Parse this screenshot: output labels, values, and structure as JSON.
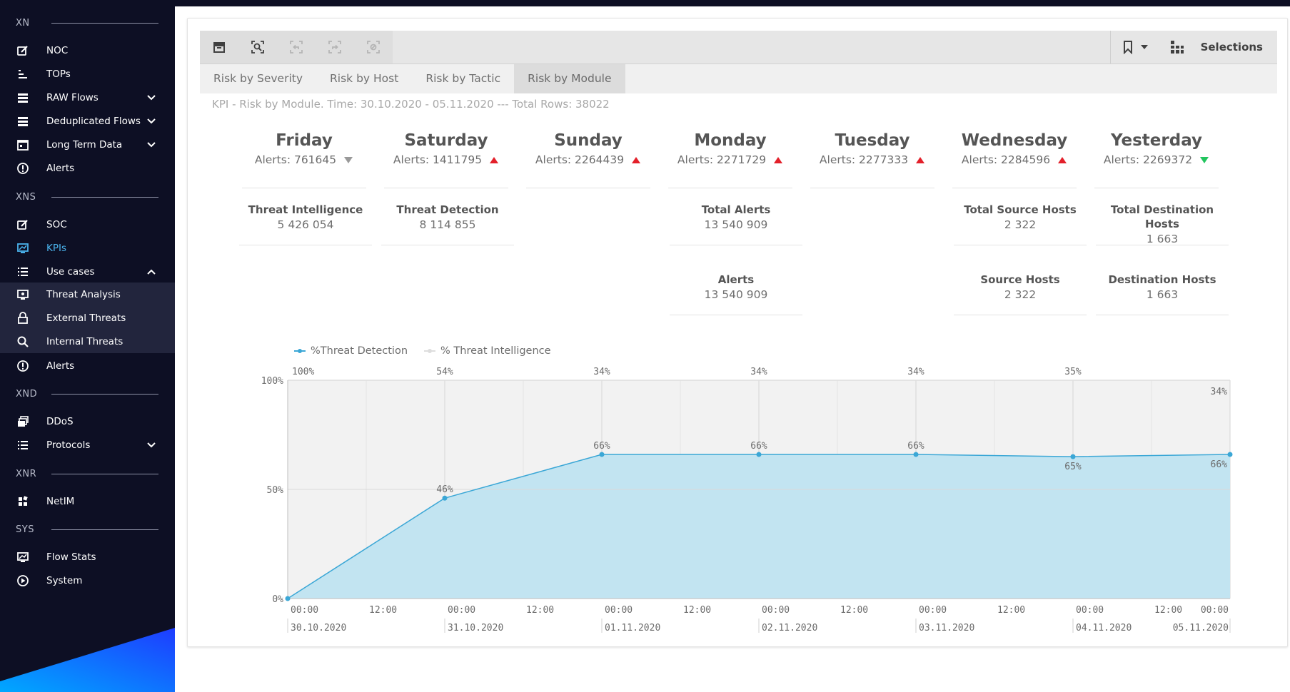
{
  "sidebar": {
    "sections": {
      "xn": "XN",
      "xns": "XNS",
      "xnd": "XND",
      "xnr": "XNR",
      "sys": "SYS"
    },
    "items": {
      "noc": "NOC",
      "tops": "TOPs",
      "raw_flows": "RAW Flows",
      "dedup_flows": "Deduplicated Flows",
      "long_term": "Long Term Data",
      "alerts1": "Alerts",
      "soc": "SOC",
      "kpis": "KPIs",
      "use_cases": "Use cases",
      "threat_analysis": "Threat Analysis",
      "external_threats": "External Threats",
      "internal_threats": "Internal Threats",
      "alerts2": "Alerts",
      "ddos": "DDoS",
      "protocols": "Protocols",
      "netim": "NetIM",
      "flow_stats": "Flow Stats",
      "system": "System"
    },
    "accent": "#4ab3ec"
  },
  "toolbar": {
    "selections_label": "Selections"
  },
  "tabs": [
    "Risk by Severity",
    "Risk by Host",
    "Risk by Tactic",
    "Risk by Module"
  ],
  "active_tab": "Risk by Module",
  "caption": "KPI - Risk by Module. Time: 30.10.2020 - 05.11.2020 --- Total Rows: 38022",
  "days": [
    {
      "name": "Friday",
      "alerts": "Alerts: 761645",
      "trend": "neutral"
    },
    {
      "name": "Saturday",
      "alerts": "Alerts: 1411795",
      "trend": "up"
    },
    {
      "name": "Sunday",
      "alerts": "Alerts: 2264439",
      "trend": "up"
    },
    {
      "name": "Monday",
      "alerts": "Alerts: 2271729",
      "trend": "up"
    },
    {
      "name": "Tuesday",
      "alerts": "Alerts: 2277333",
      "trend": "up"
    },
    {
      "name": "Wednesday",
      "alerts": "Alerts: 2284596",
      "trend": "up"
    },
    {
      "name": "Yesterday",
      "alerts": "Alerts: 2269372",
      "trend": "down"
    }
  ],
  "kpis": {
    "threat_intelligence": {
      "title": "Threat Intelligence",
      "value": "5 426 054"
    },
    "threat_detection": {
      "title": "Threat Detection",
      "value": "8 114 855"
    },
    "total_alerts": {
      "title": "Total Alerts",
      "value": "13 540 909"
    },
    "total_source_hosts": {
      "title": "Total Source Hosts",
      "value": "2 322"
    },
    "total_destination_hosts": {
      "title": "Total Destination Hosts",
      "value": "1 663"
    },
    "alerts": {
      "title": "Alerts",
      "value": "13 540 909"
    },
    "source_hosts": {
      "title": "Source Hosts",
      "value": "2 322"
    },
    "destination_hosts": {
      "title": "Destination Hosts",
      "value": "1 663"
    }
  },
  "trend_colors": {
    "up": "#e3202a",
    "down": "#22c55e",
    "neutral": "#999999"
  },
  "chart_data": {
    "type": "area",
    "legend": [
      "%Threat Detection",
      "% Threat Intelligence"
    ],
    "colors": {
      "threat_detection": "#3ba7d6",
      "threat_detection_fill": "#c2e4f1",
      "threat_intelligence": "#dddddd",
      "threat_intelligence_fill": "#f2f2f2"
    },
    "ylim": [
      0,
      100
    ],
    "y_ticks": [
      "0%",
      "50%",
      "100%"
    ],
    "x": [
      "30.10.2020 00:00",
      "31.10.2020 00:00",
      "01.11.2020 00:00",
      "02.11.2020 00:00",
      "03.11.2020 00:00",
      "04.11.2020 00:00",
      "05.11.2020 00:00"
    ],
    "x_time_ticks": [
      "00:00",
      "12:00",
      "00:00",
      "12:00",
      "00:00",
      "12:00",
      "00:00",
      "12:00",
      "00:00",
      "12:00",
      "00:00",
      "12:00",
      "00:00"
    ],
    "x_date_ticks": [
      "30.10.2020",
      "31.10.2020",
      "01.11.2020",
      "02.11.2020",
      "03.11.2020",
      "04.11.2020",
      "05.11.2020"
    ],
    "series": [
      {
        "name": "%Threat Detection",
        "values": [
          0,
          46,
          66,
          66,
          66,
          65,
          66
        ],
        "labels": [
          "",
          "46%",
          "66%",
          "66%",
          "66%",
          "65%",
          "66%"
        ]
      },
      {
        "name": "% Threat Intelligence",
        "values": [
          100,
          54,
          34,
          34,
          34,
          35,
          34
        ],
        "labels": [
          "100%",
          "54%",
          "34%",
          "34%",
          "34%",
          "35%",
          "34%"
        ]
      }
    ]
  }
}
